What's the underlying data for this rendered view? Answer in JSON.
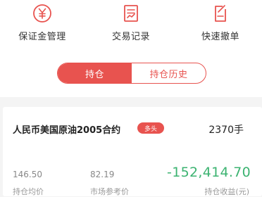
{
  "actions": [
    {
      "label": "保证金管理",
      "icon": "yuan-circle-icon"
    },
    {
      "label": "交易记录",
      "icon": "records-icon"
    },
    {
      "label": "快速撤单",
      "icon": "edit-cancel-icon"
    }
  ],
  "tabs": [
    {
      "label": "持仓",
      "active": true
    },
    {
      "label": "持仓历史",
      "active": false
    }
  ],
  "position": {
    "name": "人民币美国原油2005合约",
    "badge": "多头",
    "quantity": "2370手",
    "avg_price": "146.50",
    "avg_price_label": "持仓均价",
    "ref_price": "82.19",
    "ref_price_label": "市场参考价",
    "pnl": "-152,414.70",
    "pnl_label": "持仓收益(元)"
  },
  "colors": {
    "accent": "#e8534f",
    "profit_text": "#3cb371"
  }
}
